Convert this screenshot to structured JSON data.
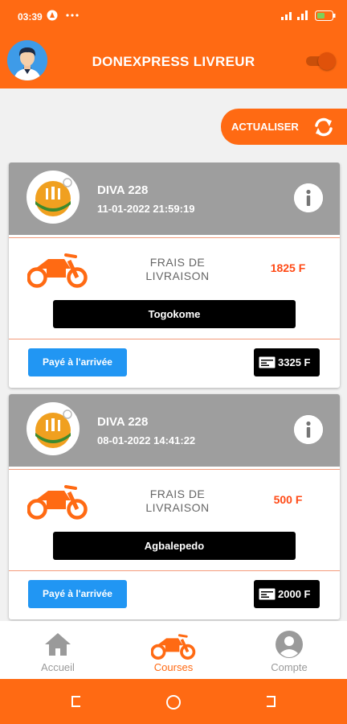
{
  "status_bar": {
    "time": "03:39",
    "icons": [
      "alert-icon",
      "more-icon",
      "signal-icon",
      "battery-icon"
    ]
  },
  "app": {
    "title": "DONEXPRESS LIVREUR"
  },
  "refresh": {
    "label": "ACTUALISER"
  },
  "orders": [
    {
      "restaurant": "DIVA 228",
      "datetime": "11-01-2022 21:59:19",
      "fee_label": "FRAIS DE LIVRAISON",
      "fee": "1825 F",
      "destination": "Togokome",
      "payment": "Payé à l'arrivée",
      "total": "3325 F"
    },
    {
      "restaurant": "DIVA 228",
      "datetime": "08-01-2022 14:41:22",
      "fee_label": "FRAIS DE LIVRAISON",
      "fee": "500 F",
      "destination": "Agbalepedo",
      "payment": "Payé à l'arrivée",
      "total": "2000 F"
    }
  ],
  "bottom_nav": [
    {
      "label": "Accueil",
      "icon": "home-icon",
      "active": false
    },
    {
      "label": "Courses",
      "icon": "motorbike-icon",
      "active": true
    },
    {
      "label": "Compte",
      "icon": "account-icon",
      "active": false
    }
  ],
  "colors": {
    "primary": "#ff6a13",
    "card_header": "#9e9e9e",
    "pay_button": "#2196f3",
    "fee_text": "#ff4a16"
  }
}
